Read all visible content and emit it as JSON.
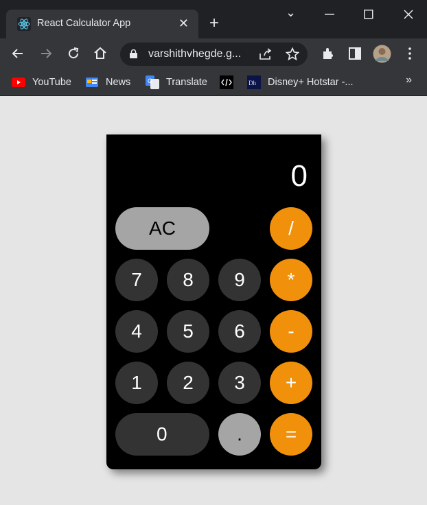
{
  "browser": {
    "tab_title": "React Calculator App",
    "tab_close": "✕",
    "new_tab": "+",
    "window_controls": {
      "dropdown": "⌄",
      "minimize": "—",
      "maximize": "☐",
      "close": "✕"
    },
    "address": "varshithvhegde.g...",
    "bookmarks": [
      {
        "label": "YouTube",
        "icon": "youtube-icon"
      },
      {
        "label": "News",
        "icon": "news-icon"
      },
      {
        "label": "Translate",
        "icon": "translate-icon"
      },
      {
        "label": "",
        "icon": "devtools-icon"
      },
      {
        "label": "Disney+ Hotstar -...",
        "icon": "hotstar-icon"
      }
    ],
    "bookmarks_more": "»"
  },
  "calculator": {
    "display": "0",
    "keys": {
      "ac": "AC",
      "divide": "/",
      "seven": "7",
      "eight": "8",
      "nine": "9",
      "multiply": "*",
      "four": "4",
      "five": "5",
      "six": "6",
      "minus": "-",
      "one": "1",
      "two": "2",
      "three": "3",
      "plus": "+",
      "zero": "0",
      "decimal": ".",
      "equals": "="
    }
  },
  "colors": {
    "orange": "#f1900b",
    "dark_key": "#333333",
    "light_key": "#a5a5a5",
    "page_bg": "#e5e5e5"
  }
}
